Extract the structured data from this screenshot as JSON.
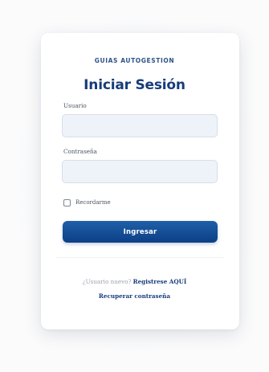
{
  "login": {
    "brand": "GUIAS AUTOGESTION",
    "title": "Iniciar Sesión",
    "username_label": "Usuario",
    "username_value": "",
    "password_label": "Contraseña",
    "password_value": "",
    "remember_label": "Recordarme",
    "remember_checked": false,
    "submit_label": "Ingresar",
    "register_question": "¿Usuario nuevo?",
    "register_link": "Registrese AQUÍ",
    "recover_link": "Recuperar contraseña"
  },
  "colors": {
    "accent": "#0c3f86",
    "title": "#173c7a",
    "input_bg": "#eef3fa"
  }
}
